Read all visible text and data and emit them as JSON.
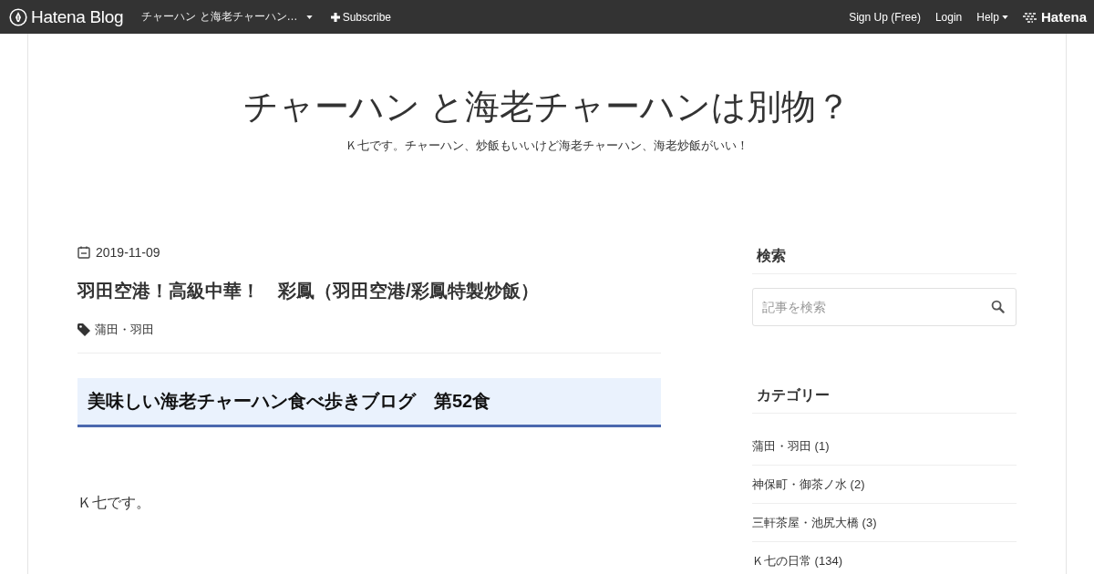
{
  "topbar": {
    "logo": "Hatena Blog",
    "blog_menu": "チャーハン と海老チャーハン…",
    "subscribe": "Subscribe",
    "links": [
      {
        "label": "Sign Up (Free)",
        "dropdown": false
      },
      {
        "label": "Login",
        "dropdown": false
      },
      {
        "label": "Help",
        "dropdown": true
      }
    ],
    "brand": "Hatena"
  },
  "header": {
    "title": "チャーハン と海老チャーハンは別物？",
    "description": "Ｋ七です。チャーハン、炒飯もいいけど海老チャーハン、海老炒飯がいい！"
  },
  "entry": {
    "date": "2019-11-09",
    "title": "羽田空港！高級中華！　彩鳳（羽田空港/彩鳳特製炒飯）",
    "categories": [
      "蒲田・羽田"
    ],
    "heading": "美味しい海老チャーハン食べ歩きブログ　第52食",
    "paragraphs": [
      "Ｋ七です。"
    ]
  },
  "sidebar": {
    "search": {
      "title": "検索",
      "placeholder": "記事を検索"
    },
    "categories": {
      "title": "カテゴリー",
      "items": [
        {
          "label": "蒲田・羽田 (1)"
        },
        {
          "label": "神保町・御茶ノ水 (2)"
        },
        {
          "label": "三軒茶屋・池尻大橋 (3)"
        },
        {
          "label": "Ｋ七の日常 (134)"
        }
      ]
    }
  }
}
